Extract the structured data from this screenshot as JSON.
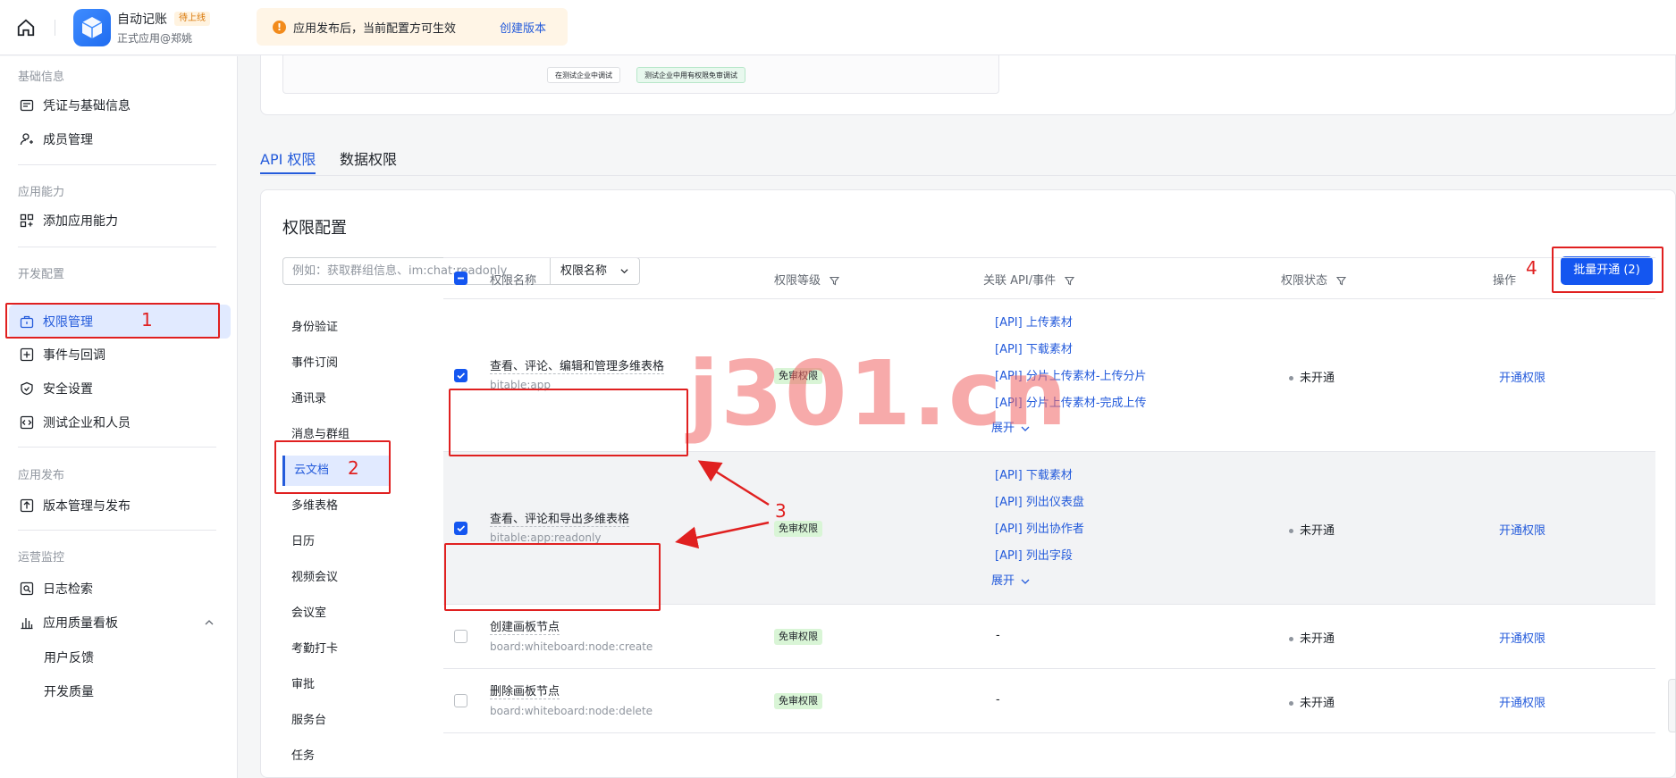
{
  "header": {
    "app_name": "自动记账",
    "app_badge": "待上线",
    "app_sub": "正式应用@郑姚",
    "notice_text": "应用发布后，当前配置方可生效",
    "notice_link": "创建版本"
  },
  "sidebar": {
    "groups": {
      "basic": "基础信息",
      "ability": "应用能力",
      "dev": "开发配置",
      "publish": "应用发布",
      "ops": "运营监控"
    },
    "items": {
      "credentials": "凭证与基础信息",
      "members": "成员管理",
      "add_ability": "添加应用能力",
      "permissions": "权限管理",
      "events": "事件与回调",
      "security": "安全设置",
      "test_corp": "测试企业和人员",
      "versions": "版本管理与发布",
      "logs": "日志检索",
      "quality": "应用质量看板",
      "feedback": "用户反馈",
      "dev_quality": "开发质量"
    }
  },
  "top_card": {
    "btn_left": "在测试企业中调试",
    "btn_right": "测试企业中用有权限免审调试"
  },
  "tabs": [
    "API 权限",
    "数据权限"
  ],
  "perm_panel": {
    "title": "权限配置",
    "search_placeholder": "例如：获取群组信息、im:chat:readonly",
    "search_mode": "权限名称",
    "batch_button": "批量开通 (2)"
  },
  "categories": [
    "身份验证",
    "事件订阅",
    "通讯录",
    "消息与群组",
    "云文档",
    "多维表格",
    "日历",
    "视频会议",
    "会议室",
    "考勤打卡",
    "审批",
    "服务台",
    "任务"
  ],
  "table": {
    "columns": [
      "权限名称",
      "权限等级",
      "关联 API/事件",
      "权限状态",
      "操作"
    ],
    "rows": [
      {
        "name": "查看、评论、编辑和管理多维表格",
        "key": "bitable:app",
        "level": "免审权限",
        "apis": [
          "[API] 上传素材",
          "[API] 下载素材",
          "[API] 分片上传素材-上传分片",
          "[API] 分片上传素材-完成上传"
        ],
        "expand": "展开",
        "status": "未开通",
        "action": "开通权限"
      },
      {
        "name": "查看、评论和导出多维表格",
        "key": "bitable:app:readonly",
        "level": "免审权限",
        "apis": [
          "[API] 下载素材",
          "[API] 列出仪表盘",
          "[API] 列出协作者",
          "[API] 列出字段"
        ],
        "expand": "展开",
        "status": "未开通",
        "action": "开通权限"
      },
      {
        "name": "创建画板节点",
        "key": "board:whiteboard:node:create",
        "level": "免审权限",
        "api_placeholder": "-",
        "status": "未开通",
        "action": "开通权限"
      },
      {
        "name": "删除画板节点",
        "key": "board:whiteboard:node:delete",
        "level": "免审权限",
        "api_placeholder": "-",
        "status": "未开通",
        "action": "开通权限"
      }
    ]
  },
  "annotations": {
    "n1": "1",
    "n2": "2",
    "n3": "3",
    "n4": "4",
    "watermark": "j301.cn"
  },
  "colors": {
    "accent": "#245bdb",
    "primary_button": "#1456f0",
    "annotation_red": "#e02020",
    "level_tag": "#d9f5d6"
  }
}
